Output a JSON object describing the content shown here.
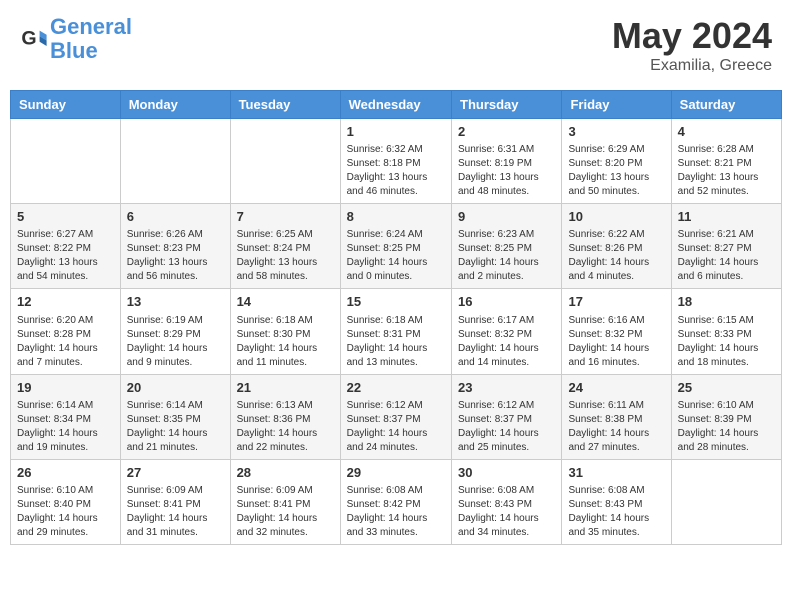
{
  "header": {
    "logo_line1": "General",
    "logo_line2": "Blue",
    "month": "May 2024",
    "location": "Examilia, Greece"
  },
  "days_of_week": [
    "Sunday",
    "Monday",
    "Tuesday",
    "Wednesday",
    "Thursday",
    "Friday",
    "Saturday"
  ],
  "weeks": [
    [
      {
        "day": "",
        "info": ""
      },
      {
        "day": "",
        "info": ""
      },
      {
        "day": "",
        "info": ""
      },
      {
        "day": "1",
        "info": "Sunrise: 6:32 AM\nSunset: 8:18 PM\nDaylight: 13 hours\nand 46 minutes."
      },
      {
        "day": "2",
        "info": "Sunrise: 6:31 AM\nSunset: 8:19 PM\nDaylight: 13 hours\nand 48 minutes."
      },
      {
        "day": "3",
        "info": "Sunrise: 6:29 AM\nSunset: 8:20 PM\nDaylight: 13 hours\nand 50 minutes."
      },
      {
        "day": "4",
        "info": "Sunrise: 6:28 AM\nSunset: 8:21 PM\nDaylight: 13 hours\nand 52 minutes."
      }
    ],
    [
      {
        "day": "5",
        "info": "Sunrise: 6:27 AM\nSunset: 8:22 PM\nDaylight: 13 hours\nand 54 minutes."
      },
      {
        "day": "6",
        "info": "Sunrise: 6:26 AM\nSunset: 8:23 PM\nDaylight: 13 hours\nand 56 minutes."
      },
      {
        "day": "7",
        "info": "Sunrise: 6:25 AM\nSunset: 8:24 PM\nDaylight: 13 hours\nand 58 minutes."
      },
      {
        "day": "8",
        "info": "Sunrise: 6:24 AM\nSunset: 8:25 PM\nDaylight: 14 hours\nand 0 minutes."
      },
      {
        "day": "9",
        "info": "Sunrise: 6:23 AM\nSunset: 8:25 PM\nDaylight: 14 hours\nand 2 minutes."
      },
      {
        "day": "10",
        "info": "Sunrise: 6:22 AM\nSunset: 8:26 PM\nDaylight: 14 hours\nand 4 minutes."
      },
      {
        "day": "11",
        "info": "Sunrise: 6:21 AM\nSunset: 8:27 PM\nDaylight: 14 hours\nand 6 minutes."
      }
    ],
    [
      {
        "day": "12",
        "info": "Sunrise: 6:20 AM\nSunset: 8:28 PM\nDaylight: 14 hours\nand 7 minutes."
      },
      {
        "day": "13",
        "info": "Sunrise: 6:19 AM\nSunset: 8:29 PM\nDaylight: 14 hours\nand 9 minutes."
      },
      {
        "day": "14",
        "info": "Sunrise: 6:18 AM\nSunset: 8:30 PM\nDaylight: 14 hours\nand 11 minutes."
      },
      {
        "day": "15",
        "info": "Sunrise: 6:18 AM\nSunset: 8:31 PM\nDaylight: 14 hours\nand 13 minutes."
      },
      {
        "day": "16",
        "info": "Sunrise: 6:17 AM\nSunset: 8:32 PM\nDaylight: 14 hours\nand 14 minutes."
      },
      {
        "day": "17",
        "info": "Sunrise: 6:16 AM\nSunset: 8:32 PM\nDaylight: 14 hours\nand 16 minutes."
      },
      {
        "day": "18",
        "info": "Sunrise: 6:15 AM\nSunset: 8:33 PM\nDaylight: 14 hours\nand 18 minutes."
      }
    ],
    [
      {
        "day": "19",
        "info": "Sunrise: 6:14 AM\nSunset: 8:34 PM\nDaylight: 14 hours\nand 19 minutes."
      },
      {
        "day": "20",
        "info": "Sunrise: 6:14 AM\nSunset: 8:35 PM\nDaylight: 14 hours\nand 21 minutes."
      },
      {
        "day": "21",
        "info": "Sunrise: 6:13 AM\nSunset: 8:36 PM\nDaylight: 14 hours\nand 22 minutes."
      },
      {
        "day": "22",
        "info": "Sunrise: 6:12 AM\nSunset: 8:37 PM\nDaylight: 14 hours\nand 24 minutes."
      },
      {
        "day": "23",
        "info": "Sunrise: 6:12 AM\nSunset: 8:37 PM\nDaylight: 14 hours\nand 25 minutes."
      },
      {
        "day": "24",
        "info": "Sunrise: 6:11 AM\nSunset: 8:38 PM\nDaylight: 14 hours\nand 27 minutes."
      },
      {
        "day": "25",
        "info": "Sunrise: 6:10 AM\nSunset: 8:39 PM\nDaylight: 14 hours\nand 28 minutes."
      }
    ],
    [
      {
        "day": "26",
        "info": "Sunrise: 6:10 AM\nSunset: 8:40 PM\nDaylight: 14 hours\nand 29 minutes."
      },
      {
        "day": "27",
        "info": "Sunrise: 6:09 AM\nSunset: 8:41 PM\nDaylight: 14 hours\nand 31 minutes."
      },
      {
        "day": "28",
        "info": "Sunrise: 6:09 AM\nSunset: 8:41 PM\nDaylight: 14 hours\nand 32 minutes."
      },
      {
        "day": "29",
        "info": "Sunrise: 6:08 AM\nSunset: 8:42 PM\nDaylight: 14 hours\nand 33 minutes."
      },
      {
        "day": "30",
        "info": "Sunrise: 6:08 AM\nSunset: 8:43 PM\nDaylight: 14 hours\nand 34 minutes."
      },
      {
        "day": "31",
        "info": "Sunrise: 6:08 AM\nSunset: 8:43 PM\nDaylight: 14 hours\nand 35 minutes."
      },
      {
        "day": "",
        "info": ""
      }
    ]
  ]
}
